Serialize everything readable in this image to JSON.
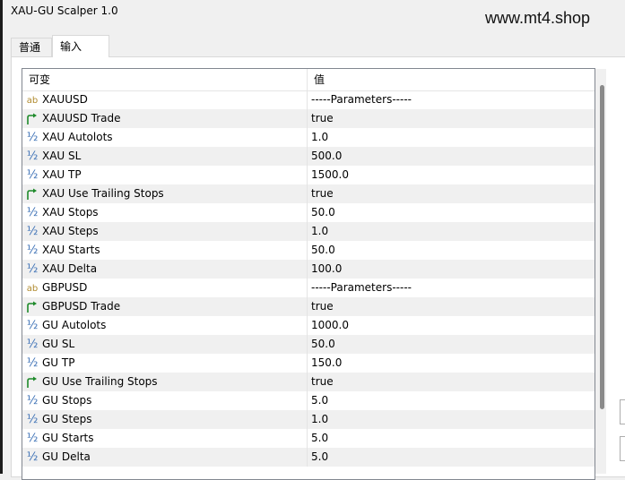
{
  "window": {
    "title": "XAU-GU Scalper 1.0"
  },
  "watermark": "www.mt4.shop",
  "tabs": [
    {
      "label": "普通"
    },
    {
      "label": "输入"
    }
  ],
  "grid": {
    "columns": {
      "name": "可变",
      "value": "值"
    },
    "rows": [
      {
        "icon": "string-icon",
        "name": "XAUUSD",
        "value": "-----Parameters-----"
      },
      {
        "icon": "bool-icon",
        "name": "XAUUSD Trade",
        "value": "true"
      },
      {
        "icon": "double-icon",
        "name": "XAU Autolots",
        "value": "1.0"
      },
      {
        "icon": "double-icon",
        "name": "XAU SL",
        "value": "500.0"
      },
      {
        "icon": "double-icon",
        "name": "XAU TP",
        "value": "1500.0"
      },
      {
        "icon": "bool-icon",
        "name": "XAU Use Trailing Stops",
        "value": "true"
      },
      {
        "icon": "double-icon",
        "name": "XAU Stops",
        "value": "50.0"
      },
      {
        "icon": "double-icon",
        "name": "XAU Steps",
        "value": "1.0"
      },
      {
        "icon": "double-icon",
        "name": "XAU Starts",
        "value": "50.0"
      },
      {
        "icon": "double-icon",
        "name": "XAU Delta",
        "value": "100.0"
      },
      {
        "icon": "string-icon",
        "name": "GBPUSD",
        "value": "-----Parameters-----"
      },
      {
        "icon": "bool-icon",
        "name": "GBPUSD Trade",
        "value": "true"
      },
      {
        "icon": "double-icon",
        "name": "GU Autolots",
        "value": "1000.0"
      },
      {
        "icon": "double-icon",
        "name": "GU SL",
        "value": "50.0"
      },
      {
        "icon": "double-icon",
        "name": "GU TP",
        "value": "150.0"
      },
      {
        "icon": "bool-icon",
        "name": "GU Use Trailing Stops",
        "value": "true"
      },
      {
        "icon": "double-icon",
        "name": "GU Stops",
        "value": "5.0"
      },
      {
        "icon": "double-icon",
        "name": "GU Steps",
        "value": "1.0"
      },
      {
        "icon": "double-icon",
        "name": "GU Starts",
        "value": "5.0"
      },
      {
        "icon": "double-icon",
        "name": "GU Delta",
        "value": "5.0"
      }
    ]
  }
}
